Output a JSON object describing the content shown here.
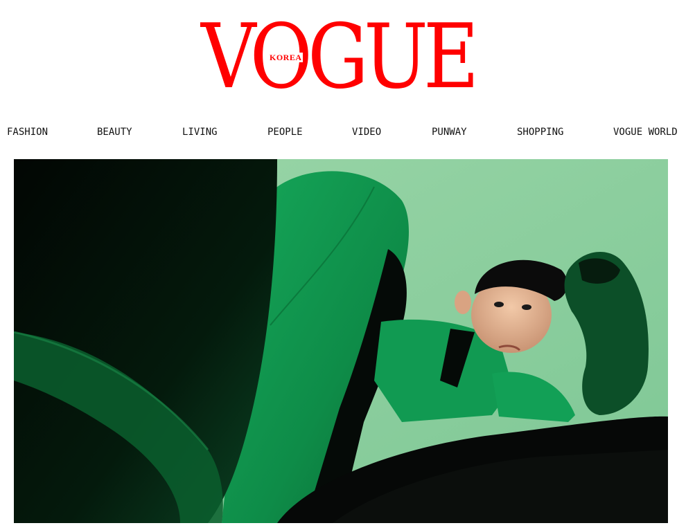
{
  "logo": {
    "wordmark": "VOGUE",
    "edition": "KOREA",
    "color": "#ff0000"
  },
  "nav": {
    "items": [
      {
        "label": "FASHION"
      },
      {
        "label": "BEAUTY"
      },
      {
        "label": "LIVING"
      },
      {
        "label": "PEOPLE"
      },
      {
        "label": "VIDEO"
      },
      {
        "label": "PUNWAY"
      },
      {
        "label": "SHOPPING"
      },
      {
        "label": "VOGUE WORLD"
      }
    ]
  },
  "hero": {
    "image_icon": "editorial-photo",
    "palette": {
      "background": "#8fcf9e",
      "green": "#0f9a4f",
      "dark_green": "#0a5a2c",
      "black": "#050a07"
    }
  }
}
